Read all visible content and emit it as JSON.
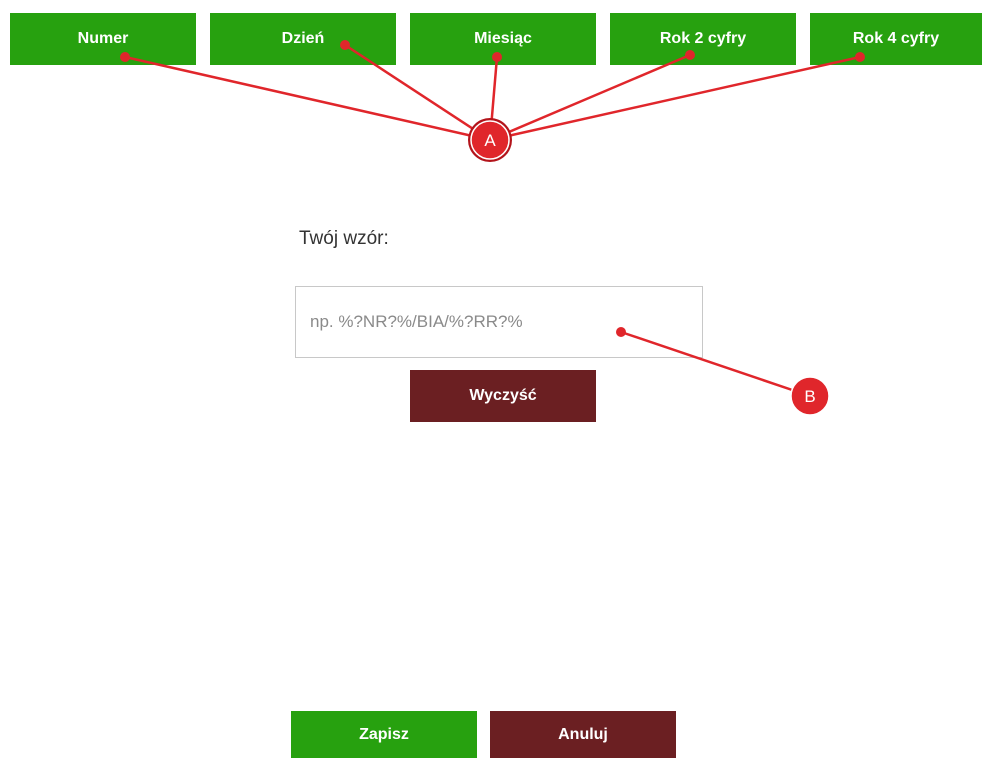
{
  "colors": {
    "accent_green": "#27a10f",
    "accent_maroon": "#6b1f22",
    "annotation_red": "#e0262b"
  },
  "tokens": {
    "numer": "Numer",
    "dzien": "Dzień",
    "miesiac": "Miesiąc",
    "rok2": "Rok 2 cyfry",
    "rok4": "Rok 4 cyfry"
  },
  "pattern": {
    "label": "Twój wzór:",
    "placeholder": "np. %?NR?%/BIA/%?RR?%",
    "value": ""
  },
  "actions": {
    "clear": "Wyczyść",
    "save": "Zapisz",
    "cancel": "Anuluj"
  },
  "annotations": {
    "a_label": "A",
    "b_label": "B"
  }
}
